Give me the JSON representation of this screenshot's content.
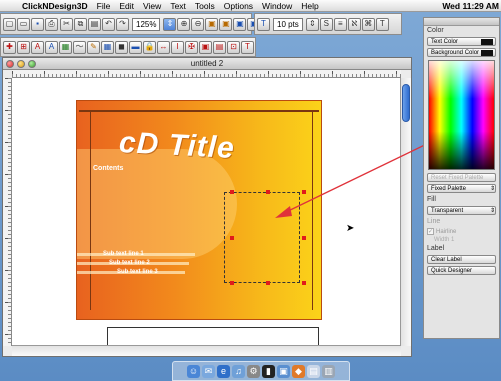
{
  "menubar": {
    "apple_glyph": "",
    "app_name": "ClickNDesign3D",
    "items": [
      "File",
      "Edit",
      "View",
      "Text",
      "Tools",
      "Options",
      "Window",
      "Help"
    ],
    "clock": "Wed 11:29 AM"
  },
  "toolbar_top": {
    "icons": [
      "new-icon",
      "open-icon",
      "save-icon",
      "print-icon",
      "cut-icon",
      "copy-icon",
      "paste-icon",
      "undo-icon",
      "redo-icon"
    ],
    "zoom_value": "125%",
    "zoom_icons": [
      "zoom-stepper-icon",
      "zoom-in-icon",
      "zoom-out-icon",
      "bring-forward-icon",
      "send-backward-icon",
      "bring-front-icon",
      "send-back-icon"
    ],
    "font_size_value": "10 pts",
    "text_tool_glyph": "T",
    "style_glyphs": [
      "S",
      "≡",
      "ℵ",
      "⌘",
      "T"
    ]
  },
  "toolbar_second": {
    "glyphs": [
      "✚",
      "⊞",
      "A",
      "A",
      "▦",
      "〜",
      "✎",
      "▦",
      "◼",
      "▬",
      "🔒",
      "↔",
      "I",
      "✠",
      "▣",
      "▤",
      "⊡",
      "T"
    ]
  },
  "document": {
    "title": "untitled 2"
  },
  "cover": {
    "title": "cD Title",
    "contents_label": "Contents",
    "sub_lines": [
      "Sub text line 1",
      "Sub text line 2",
      "Sub text line 3"
    ]
  },
  "palette": {
    "color_header": "Color",
    "text_color_label": "Text Color",
    "background_color_label": "Background Color",
    "reset_fixed_palette": "Reset Fixed Palette",
    "fixed_palette": "Fixed Palette",
    "fill_header": "Fill",
    "fill_value": "Transparent",
    "line_header": "Line",
    "hairline_label": "Hairline",
    "width_label": "Width",
    "width_value": "1",
    "label_header": "Label",
    "clear_label": "Clear Label",
    "quick_designer": "Quick Designer"
  },
  "colors": {
    "desktop": "#6b98cc",
    "cover_left": "#e8621f",
    "cover_right": "#fbd319",
    "arrow": "#e0323a",
    "handle": "#e01b1b"
  },
  "dock": {
    "icons": [
      "finder-icon",
      "mail-icon",
      "ie-icon",
      "itunes-icon",
      "prefs-icon",
      "terminal-icon",
      "photo-icon",
      "app-icon",
      "doc-icon",
      "trash-icon"
    ]
  }
}
